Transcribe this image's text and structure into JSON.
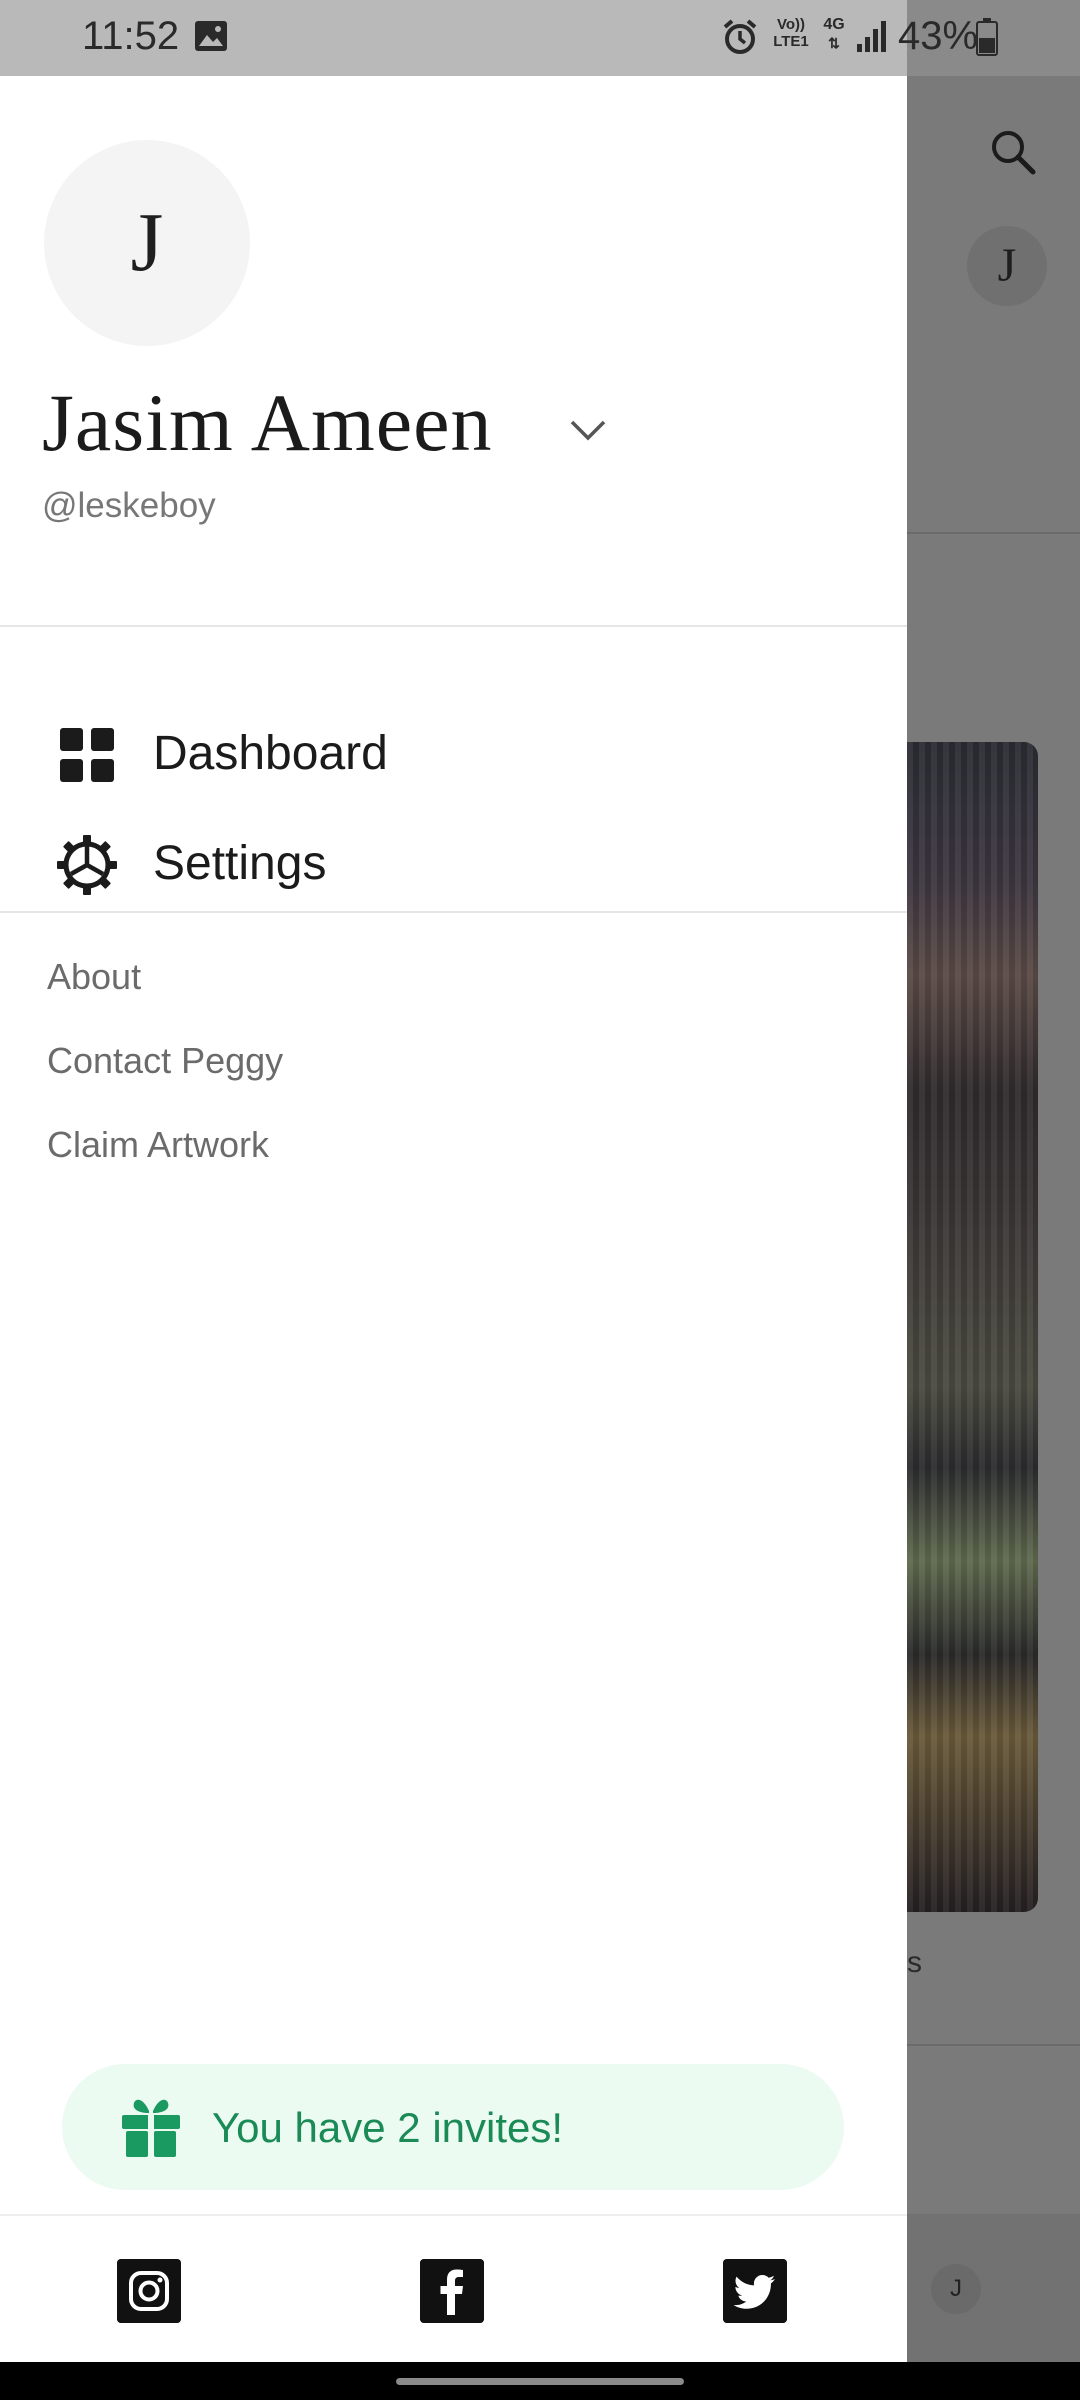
{
  "status_bar": {
    "time": "11:52",
    "volte_top": "Vo))",
    "volte_bottom": "LTE1",
    "network": "4G",
    "battery": "43%"
  },
  "background_app": {
    "avatar_letter": "J",
    "partial_text": "s",
    "mini_avatar_letter": "J"
  },
  "drawer": {
    "avatar_letter": "J",
    "user_name": "Jasim Ameen",
    "user_handle": "@leskeboy",
    "menu": [
      {
        "label": "Dashboard",
        "icon": "grid-icon"
      },
      {
        "label": "Settings",
        "icon": "gear-icon"
      }
    ],
    "links": [
      "About",
      "Contact Peggy",
      "Claim Artwork"
    ],
    "invite_text": "You have 2 invites!",
    "social": [
      "instagram-icon",
      "facebook-icon",
      "twitter-icon"
    ]
  },
  "colors": {
    "invite_bg": "#ecfbf1",
    "invite_accent": "#1a8a57",
    "scrim": "#7a7a7a"
  }
}
